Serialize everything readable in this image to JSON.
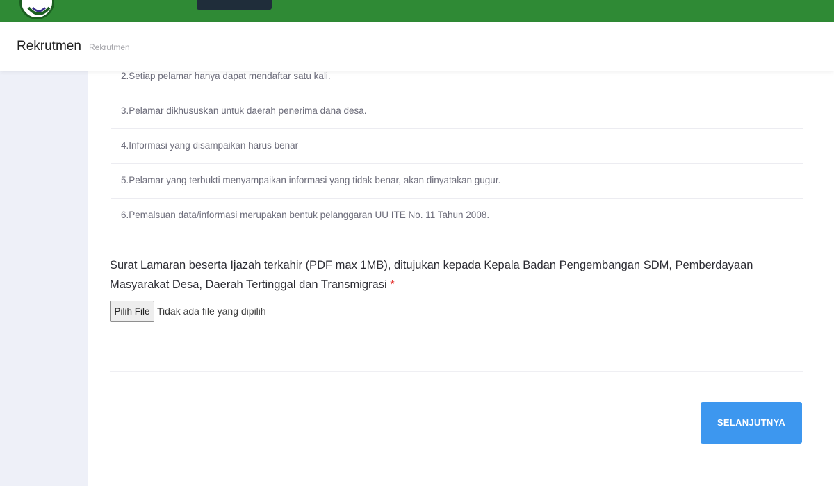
{
  "header": {
    "title": "Rekrutmen",
    "breadcrumb": "Rekrutmen",
    "brand_color": "#2f8a35"
  },
  "rules": [
    "2.Setiap pelamar hanya dapat mendaftar satu kali.",
    "3.Pelamar dikhususkan untuk daerah penerima dana desa.",
    "4.Informasi yang disampaikan harus benar",
    "5.Pelamar yang terbukti menyampaikan informasi yang tidak benar, akan dinyatakan gugur.",
    "6.Pemalsuan data/informasi merupakan bentuk pelanggaran UU ITE No. 11 Tahun 2008."
  ],
  "upload": {
    "label": "Surat Lamaran beserta Ijazah terkahir (PDF max 1MB), ditujukan kepada Kepala Badan Pengembangan SDM, Pemberdayaan Masyarakat Desa, Daerah Tertinggal dan Transmigrasi",
    "required_mark": "*",
    "button_label": "Pilih File",
    "status": "Tidak ada file yang dipilih"
  },
  "actions": {
    "next_label": "SELANJUTNYA",
    "next_color": "#3d97ef"
  },
  "icons": {
    "logo": "logo-icon"
  }
}
